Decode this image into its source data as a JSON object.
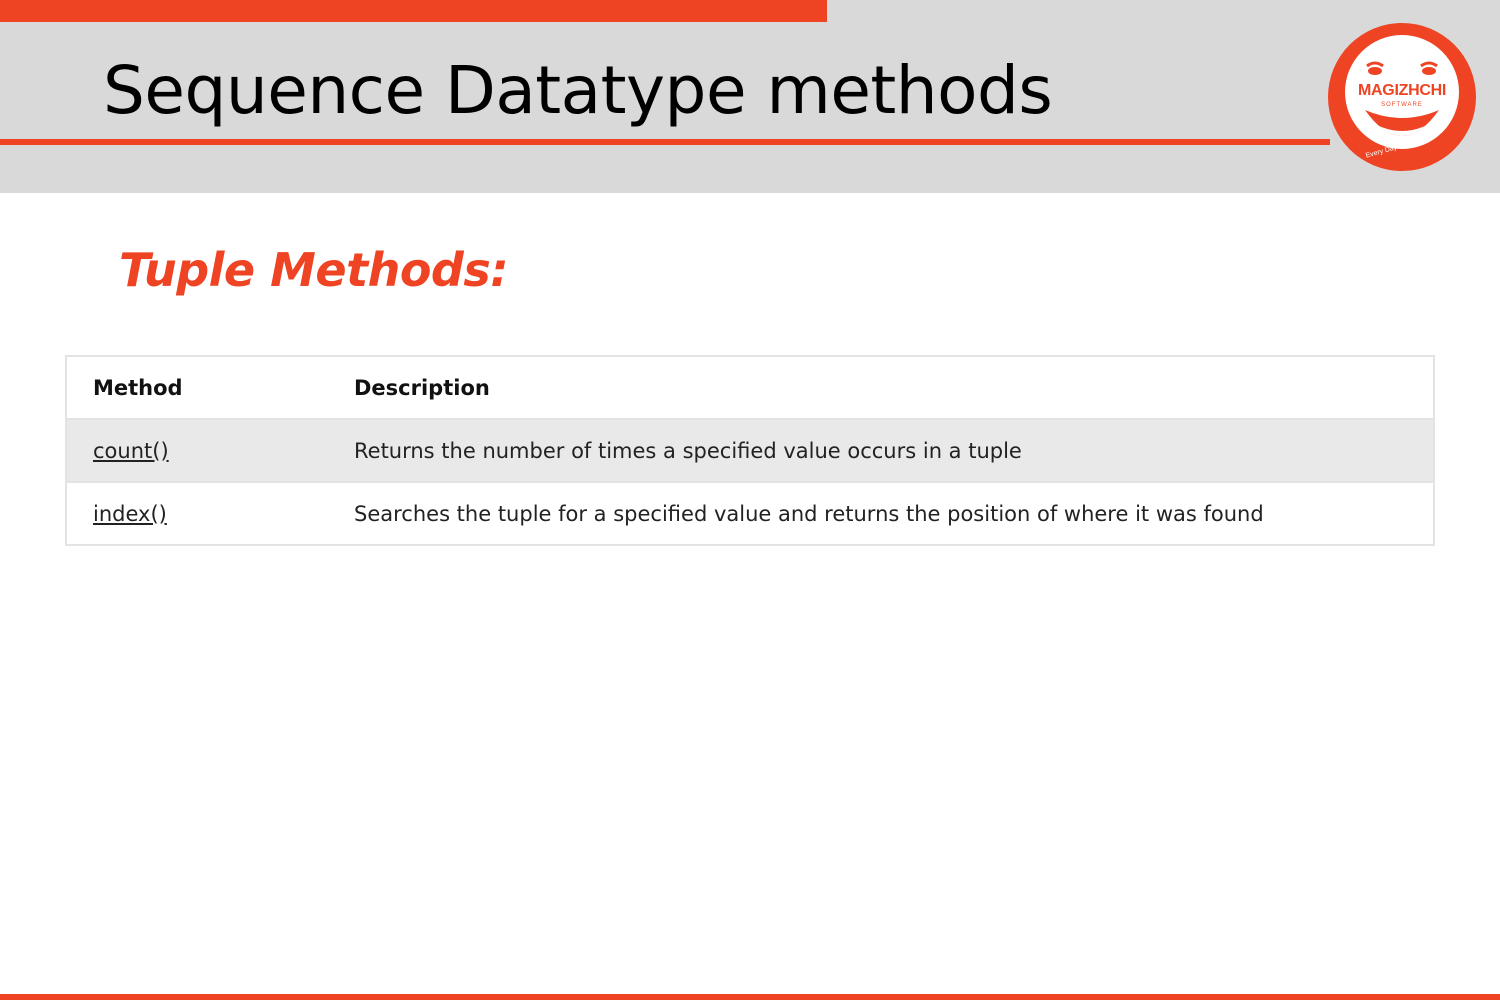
{
  "slide": {
    "title": "Sequence Datatype methods",
    "section_heading": "Tuple Methods:"
  },
  "logo": {
    "brand": "MAGIZHCHI",
    "sub": "SOFTWARE",
    "tagline": "Every Day Happy Day",
    "icon": "smiling-face-logo"
  },
  "table": {
    "headers": {
      "method": "Method",
      "description": "Description"
    },
    "rows": [
      {
        "method": "count()",
        "description": "Returns the number of times a specified value occurs in a tuple"
      },
      {
        "method": "index()",
        "description": "Searches the tuple for a specified value and returns the position of where it was found"
      }
    ]
  },
  "colors": {
    "accent": "#ee4423",
    "header_band": "#d9d9d9",
    "shaded_row": "#e9e9e9"
  }
}
